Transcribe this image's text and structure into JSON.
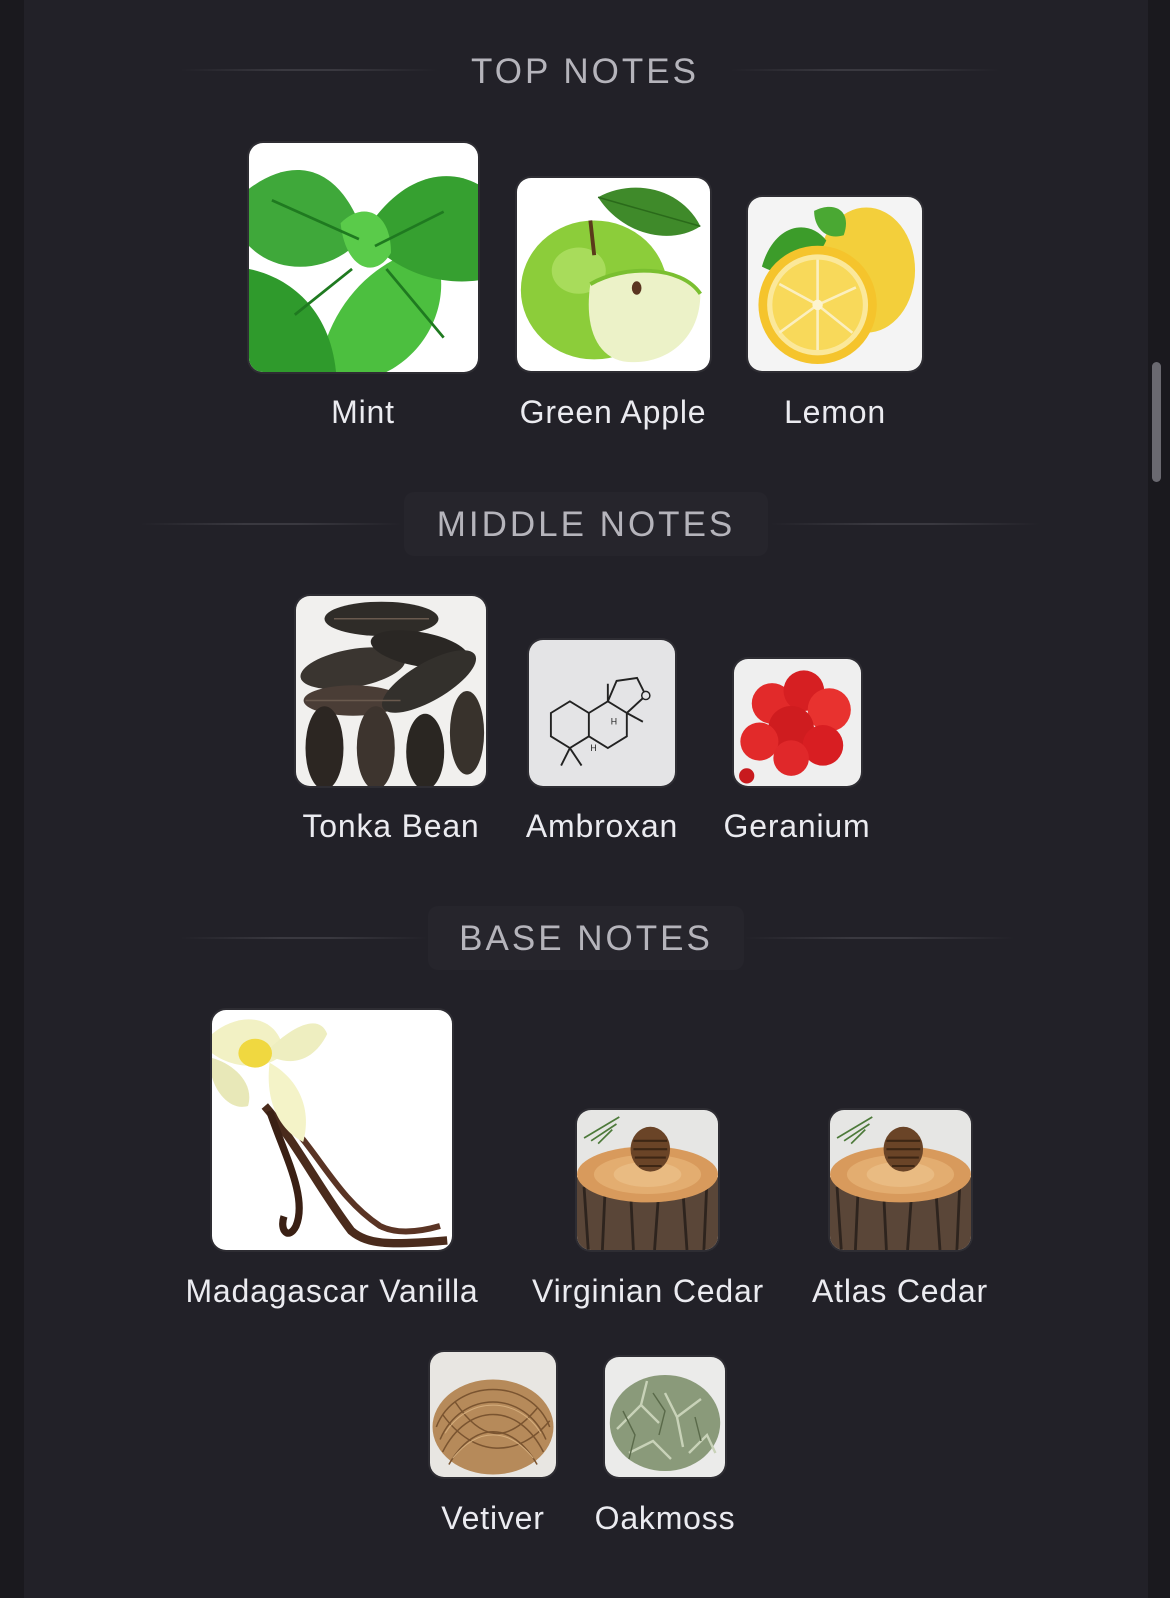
{
  "sections": {
    "top": {
      "title": "TOP NOTES",
      "notes": [
        {
          "label": "Mint",
          "icon": "mint-image"
        },
        {
          "label": "Green Apple",
          "icon": "green-apple-image"
        },
        {
          "label": "Lemon",
          "icon": "lemon-image"
        }
      ]
    },
    "middle": {
      "title": "MIDDLE NOTES",
      "notes": [
        {
          "label": "Tonka Bean",
          "icon": "tonka-bean-image"
        },
        {
          "label": "Ambroxan",
          "icon": "ambroxan-molecule-image"
        },
        {
          "label": "Geranium",
          "icon": "geranium-image"
        }
      ]
    },
    "base": {
      "title": "BASE NOTES",
      "notes": [
        {
          "label": "Madagascar Vanilla",
          "icon": "vanilla-image"
        },
        {
          "label": "Virginian Cedar",
          "icon": "cedar-image"
        },
        {
          "label": "Atlas Cedar",
          "icon": "cedar-image"
        },
        {
          "label": "Vetiver",
          "icon": "vetiver-image"
        },
        {
          "label": "Oakmoss",
          "icon": "oakmoss-image"
        }
      ]
    }
  },
  "colors": {
    "background": "#222128",
    "title_text": "#b5b4bb",
    "label_text": "#ebebf0"
  }
}
